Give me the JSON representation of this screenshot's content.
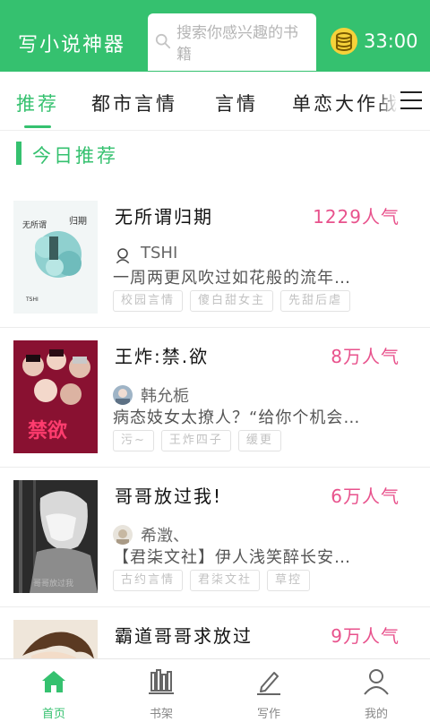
{
  "header": {
    "title": "写小说神器",
    "search_placeholder": "搜索你感兴趣的书籍",
    "coins": "33:00",
    "icons": {
      "search": "search-icon",
      "coin": "coin-stack-icon"
    },
    "colors": {
      "primary": "#35c16f"
    }
  },
  "tabs": [
    {
      "label": "推荐",
      "active": true
    },
    {
      "label": "都市言情"
    },
    {
      "label": "言情"
    },
    {
      "label": "单恋大作战"
    }
  ],
  "section": {
    "title": "今日推荐"
  },
  "books": [
    {
      "title": "无所谓归期",
      "popularity": "1229人气",
      "author": "TSHI",
      "description": "一周两更风吹过如花般的流年…",
      "tags": [
        "校园言情",
        "傻白甜女主",
        "先甜后虐"
      ]
    },
    {
      "title": "王炸:禁.欲",
      "popularity": "8万人气",
      "author": "韩允栀",
      "description": "病态妓女太撩人？“给你个机会…",
      "tags": [
        "污~",
        "王炸四子",
        "缓更"
      ],
      "cover_text": "禁欲"
    },
    {
      "title": "哥哥放过我!",
      "popularity": "6万人气",
      "author": "希澂、",
      "description": "【君柒文社】伊人浅笑醉长安…",
      "tags": [
        "古约言情",
        "君柒文社",
        "草控"
      ]
    },
    {
      "title": "霸道哥哥求放过",
      "popularity": "9万人气"
    }
  ],
  "bottom_nav": [
    {
      "label": "首页",
      "icon": "home-icon",
      "active": true
    },
    {
      "label": "书架",
      "icon": "bookshelf-icon"
    },
    {
      "label": "写作",
      "icon": "pencil-icon"
    },
    {
      "label": "我的",
      "icon": "user-icon"
    }
  ],
  "accent_pink": "#e8528c"
}
